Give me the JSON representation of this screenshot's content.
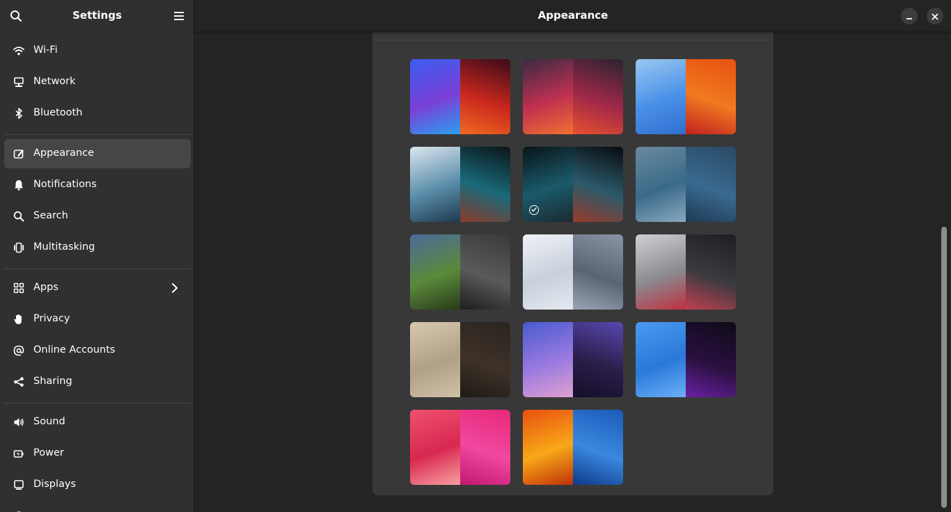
{
  "sidebar": {
    "title": "Settings",
    "groups": [
      [
        {
          "label": "Wi-Fi",
          "icon": "wifi-icon"
        },
        {
          "label": "Network",
          "icon": "network-icon"
        },
        {
          "label": "Bluetooth",
          "icon": "bluetooth-icon"
        }
      ],
      [
        {
          "label": "Appearance",
          "icon": "appearance-icon",
          "active": true
        },
        {
          "label": "Notifications",
          "icon": "bell-icon"
        },
        {
          "label": "Search",
          "icon": "search-icon"
        },
        {
          "label": "Multitasking",
          "icon": "multitasking-icon"
        }
      ],
      [
        {
          "label": "Apps",
          "icon": "apps-icon",
          "has_submenu": true
        },
        {
          "label": "Privacy",
          "icon": "hand-icon"
        },
        {
          "label": "Online Accounts",
          "icon": "at-icon"
        },
        {
          "label": "Sharing",
          "icon": "share-icon"
        }
      ],
      [
        {
          "label": "Sound",
          "icon": "speaker-icon"
        },
        {
          "label": "Power",
          "icon": "power-icon"
        },
        {
          "label": "Displays",
          "icon": "display-icon"
        }
      ]
    ]
  },
  "header": {
    "title": "Appearance"
  },
  "wallpapers": [
    {
      "name": "blobs-triangles",
      "left": [
        "#3b5ef0",
        "#7a3fd6",
        "#2aa0f0"
      ],
      "right": [
        "#3a0a1a",
        "#c8281e",
        "#f06a20"
      ]
    },
    {
      "name": "waves-purple",
      "left": [
        "#3a2a44",
        "#c03050",
        "#f07030"
      ],
      "right": [
        "#2a2230",
        "#a02848",
        "#e85030"
      ]
    },
    {
      "name": "drips",
      "left": [
        "#9ac8f0",
        "#4a90e8",
        "#2f6fd0"
      ],
      "right": [
        "#e85010",
        "#f07a20",
        "#c02020"
      ]
    },
    {
      "name": "bubbles-light",
      "left": [
        "#dce6ee",
        "#5a8eaa",
        "#1e3a4e"
      ],
      "right": [
        "#0a1418",
        "#1a6a7a",
        "#8a3a2a"
      ]
    },
    {
      "name": "bubbles-dark",
      "left": [
        "#0a1418",
        "#1a5a6a",
        "#1a2a30"
      ],
      "right": [
        "#0a0a10",
        "#2a5a6a",
        "#9a3a2a"
      ],
      "selected": true
    },
    {
      "name": "glass-swirls",
      "left": [
        "#6a8aa0",
        "#3a6a88",
        "#88a8c0"
      ],
      "right": [
        "#2a4a66",
        "#3a6a90",
        "#1e3a52"
      ]
    },
    {
      "name": "shards-green",
      "left": [
        "#4a6a9a",
        "#5a8a3a",
        "#2a3a1a"
      ],
      "right": [
        "#3a3a3a",
        "#5a5a5a",
        "#1e1e1e"
      ]
    },
    {
      "name": "silk-white",
      "left": [
        "#f0f2f6",
        "#c8d0dc",
        "#e6eaf0"
      ],
      "right": [
        "#8a94a4",
        "#5a6474",
        "#9aa4b4"
      ]
    },
    {
      "name": "blocks",
      "left": [
        "#d0d0d4",
        "#8a8a90",
        "#c03040"
      ],
      "right": [
        "#1e1e22",
        "#3a3a40",
        "#c04050"
      ]
    },
    {
      "name": "beige-lines",
      "left": [
        "#d8c8b0",
        "#b0a088",
        "#cec0a6"
      ],
      "right": [
        "#2a2420",
        "#3e3228",
        "#1e1a16"
      ]
    },
    {
      "name": "crystal-sky",
      "left": [
        "#4a5ad0",
        "#9a7ae0",
        "#e0a0d0"
      ],
      "right": [
        "#5a48b0",
        "#2a1e4a",
        "#140e28"
      ]
    },
    {
      "name": "blue-purple-glow",
      "left": [
        "#4a9af0",
        "#2a78d8",
        "#6ab0f8"
      ],
      "right": [
        "#0e0a18",
        "#2a1040",
        "#6a20a0"
      ]
    },
    {
      "name": "chains-pink",
      "left": [
        "#f05070",
        "#d82850",
        "#f8a0a0"
      ],
      "right": [
        "#e82878",
        "#f048a0",
        "#c01870"
      ]
    },
    {
      "name": "mosaic-orange-blue",
      "left": [
        "#e85010",
        "#f8a818",
        "#c03008"
      ],
      "right": [
        "#1a5ab8",
        "#3a88e0",
        "#0e3a88"
      ]
    }
  ]
}
